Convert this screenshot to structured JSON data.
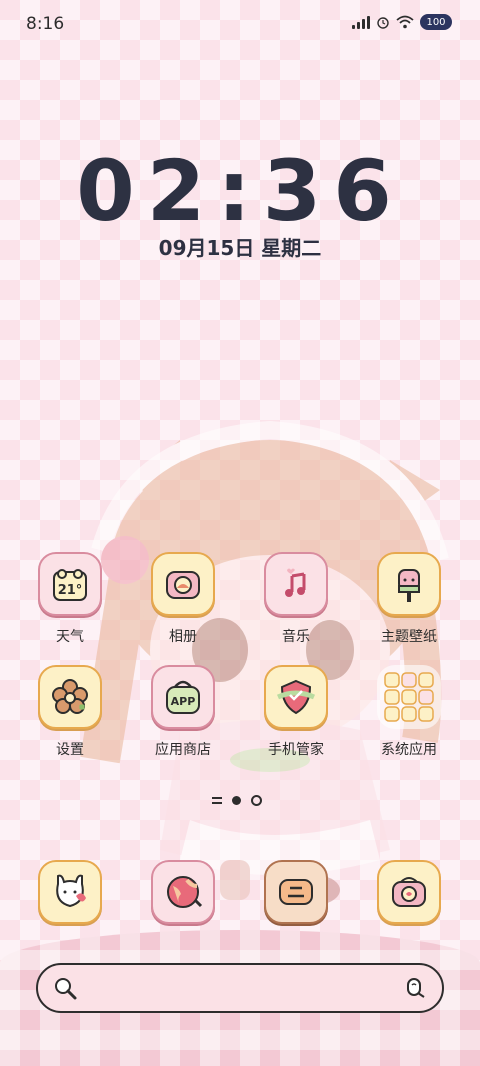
{
  "status_bar": {
    "time": "8:16",
    "battery": "100"
  },
  "clock": {
    "time": "02:36",
    "date": "09月15日 星期二"
  },
  "apps": [
    {
      "label": "天气",
      "icon": "weather-calendar-icon",
      "badge": "21°"
    },
    {
      "label": "相册",
      "icon": "gallery-icon"
    },
    {
      "label": "音乐",
      "icon": "music-icon"
    },
    {
      "label": "主题壁纸",
      "icon": "theme-wallpaper-icon"
    },
    {
      "label": "设置",
      "icon": "settings-flower-icon"
    },
    {
      "label": "应用商店",
      "icon": "app-store-bag-icon",
      "badge": "APP"
    },
    {
      "label": "手机管家",
      "icon": "phone-manager-shield-icon"
    },
    {
      "label": "系统应用",
      "icon": "system-apps-folder-icon"
    }
  ],
  "dock": [
    {
      "icon": "phone-bunny-icon"
    },
    {
      "icon": "browser-globe-icon"
    },
    {
      "icon": "messages-icon"
    },
    {
      "icon": "camera-icon"
    }
  ],
  "page_indicator": {
    "pages": 2,
    "active": 1
  },
  "colors": {
    "background": "#fbe3ea",
    "clock": "#2d3142",
    "icon_border": "#e7a94e",
    "icon_fill": "#fdf1c7",
    "battery": "#2c3560"
  }
}
